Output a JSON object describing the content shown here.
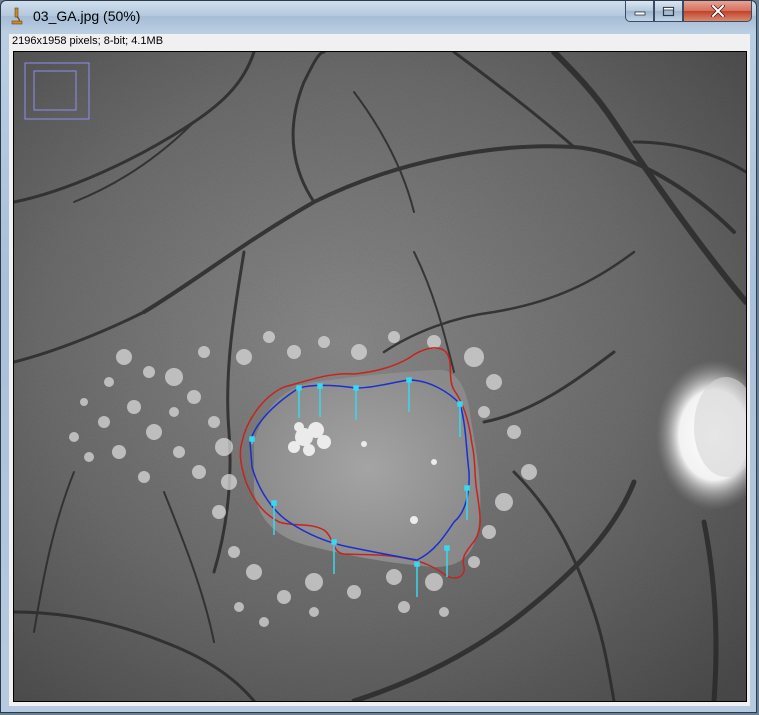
{
  "window": {
    "title": "03_GA.jpg (50%)"
  },
  "status_bar": {
    "image_info": "2196x1958 pixels; 8-bit; 4.1MB"
  },
  "colors": {
    "ga_boundary_manual": "#c8231e",
    "ga_boundary_auto": "#1a2fd0",
    "control_points": "#38d8f0",
    "navigator": "#8d8df0"
  },
  "icons": {
    "app": "imagej-microscope-icon",
    "minimize": "minimize-icon",
    "maximize": "maximize-icon",
    "close": "close-icon"
  }
}
